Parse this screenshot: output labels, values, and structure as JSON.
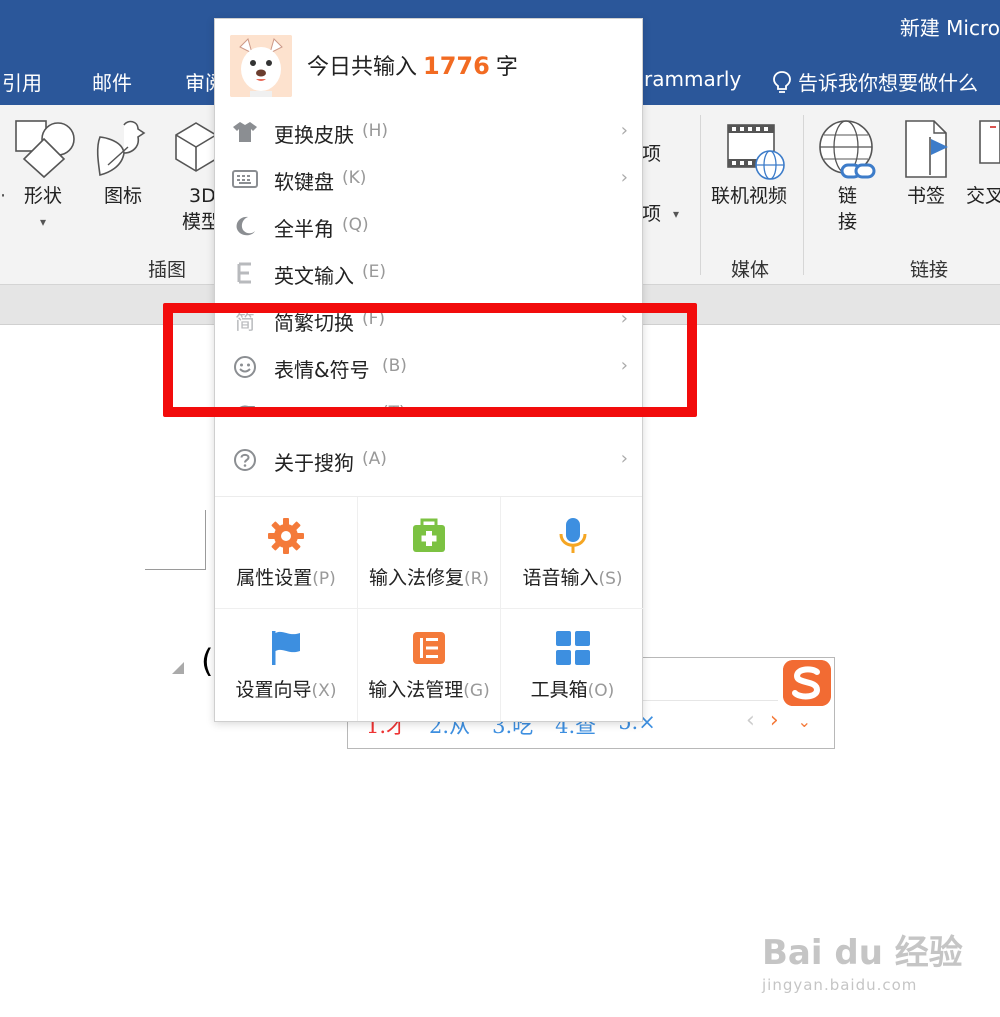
{
  "window": {
    "title": "新建 Micro"
  },
  "tabs": [
    {
      "label": "引用"
    },
    {
      "label": "邮件"
    },
    {
      "label": "审阅"
    },
    {
      "label": "rammarly"
    }
  ],
  "tell_me": {
    "label": "告诉我你想要做什么"
  },
  "ribbon": {
    "shapes_label": "形状",
    "icons_label": "图标",
    "model3d_label_1": "3D",
    "model3d_label_2": "模型",
    "item_a_label": "项",
    "item_b_label": "项",
    "online_video_label": "联机视频",
    "link_label_1": "链",
    "link_label_2": "接",
    "bookmark_label": "书签",
    "crossref_label": "交叉",
    "groups": {
      "illustrations": "插图",
      "media": "媒体",
      "links": "链接"
    }
  },
  "ime_menu": {
    "header": {
      "prefix": "今日共输入",
      "count": "1776",
      "suffix": "字"
    },
    "items": [
      {
        "label": "更换皮肤",
        "key": "(H)",
        "icon": "shirt-icon",
        "submenu": true
      },
      {
        "label": "软键盘",
        "key": "(K)",
        "icon": "keyboard-icon",
        "submenu": true
      },
      {
        "label": "全半角",
        "key": "(Q)",
        "icon": "moon-icon",
        "submenu": false
      },
      {
        "label": "英文输入",
        "key": "(E)",
        "icon": "letter-e-icon",
        "submenu": false
      },
      {
        "label": "简繁切换",
        "key": "(F)",
        "icon": "jian-icon",
        "icon_text": "简",
        "submenu": true
      },
      {
        "label": "表情&符号",
        "key": "(B)",
        "icon": "smiley-icon",
        "submenu": true
      },
      {
        "label": "恢复状态栏",
        "key": "(T)",
        "icon": "restore-icon",
        "submenu": false
      },
      {
        "label": "关于搜狗",
        "key": "(A)",
        "icon": "help-icon",
        "submenu": true
      }
    ],
    "tools": [
      {
        "label": "属性设置",
        "key": "(P)",
        "icon": "gear-icon",
        "color": "#f47a3a"
      },
      {
        "label": "输入法修复",
        "key": "(R)",
        "icon": "medkit-icon",
        "color": "#7cc242"
      },
      {
        "label": "语音输入",
        "key": "(S)",
        "icon": "microphone-icon",
        "color": "#3d8fe0"
      },
      {
        "label": "设置向导",
        "key": "(X)",
        "icon": "flag-icon",
        "color": "#3d8fe0"
      },
      {
        "label": "输入法管理",
        "key": "(G)",
        "icon": "manage-icon",
        "color": "#f47a3a"
      },
      {
        "label": "工具箱",
        "key": "(O)",
        "icon": "grid-icon",
        "color": "#3d8fe0"
      }
    ]
  },
  "candidates": {
    "items": [
      "1.才",
      "2.从",
      "3.吃",
      "4.查",
      "5.×"
    ],
    "prev": "‹",
    "next": "›",
    "more": "⌄",
    "logo_letter": "S"
  },
  "watermark": {
    "main": "Bai du 经验",
    "sub": "jingyan.baidu.com"
  },
  "colors": {
    "word_blue": "#2b579a",
    "sogou_orange": "#f26b22",
    "highlight_red": "#f20c0c"
  }
}
